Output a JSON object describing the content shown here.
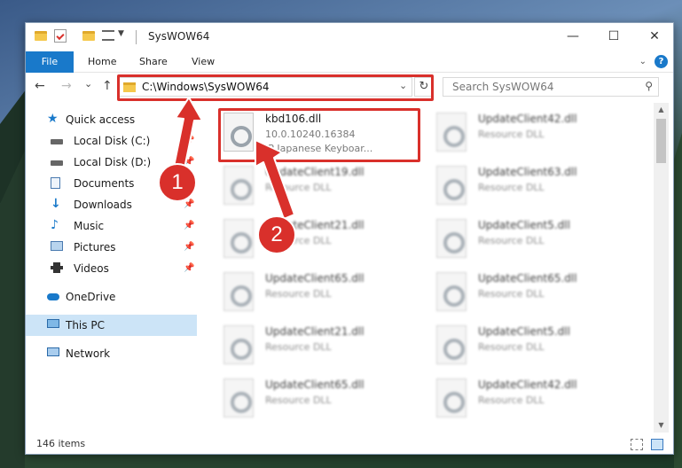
{
  "window": {
    "title": "SysWOW64",
    "controls": {
      "minimize": "—",
      "maximize": "☐",
      "close": "✕"
    }
  },
  "ribbon": {
    "tabs": [
      "File",
      "Home",
      "Share",
      "View"
    ],
    "help": "?"
  },
  "nav": {
    "back": "←",
    "forward": "→",
    "recent": "⌄",
    "up": "↑",
    "address": "C:\\Windows\\SysWOW64",
    "address_dropdown": "⌄",
    "refresh": "↻",
    "search_placeholder": "Search SysWOW64"
  },
  "sidebar": {
    "items": [
      {
        "label": "Quick access",
        "icon": "star-icon",
        "pinned": false,
        "level": 0
      },
      {
        "label": "Local Disk (C:)",
        "icon": "drive-icon",
        "pinned": true,
        "level": 1
      },
      {
        "label": "Local Disk (D:)",
        "icon": "drive-icon",
        "pinned": true,
        "level": 1
      },
      {
        "label": "Documents",
        "icon": "documents-icon",
        "pinned": true,
        "level": 1
      },
      {
        "label": "Downloads",
        "icon": "download-icon",
        "pinned": true,
        "level": 1
      },
      {
        "label": "Music",
        "icon": "music-icon",
        "pinned": true,
        "level": 1
      },
      {
        "label": "Pictures",
        "icon": "pictures-icon",
        "pinned": true,
        "level": 1
      },
      {
        "label": "Videos",
        "icon": "videos-icon",
        "pinned": true,
        "level": 1
      },
      {
        "label": "OneDrive",
        "icon": "cloud-icon",
        "pinned": false,
        "level": 0
      },
      {
        "label": "This PC",
        "icon": "computer-icon",
        "pinned": false,
        "level": 0,
        "selected": true
      },
      {
        "label": "Network",
        "icon": "network-icon",
        "pinned": false,
        "level": 0
      }
    ],
    "pin_glyph": "📌"
  },
  "files": {
    "left": [
      {
        "name": "kbd106.dll",
        "sub": "10.0.10240.16384",
        "sub2": "JP Japanese Keyboar...",
        "highlighted": true
      },
      {
        "name": "UpdateClient19.dll",
        "sub": "Resource DLL"
      },
      {
        "name": "UpdateClient21.dll",
        "sub": "Resource DLL"
      },
      {
        "name": "UpdateClient65.dll",
        "sub": "Resource DLL"
      },
      {
        "name": "UpdateClient21.dll",
        "sub": "Resource DLL"
      },
      {
        "name": "UpdateClient65.dll",
        "sub": "Resource DLL"
      }
    ],
    "right": [
      {
        "name": "UpdateClient42.dll",
        "sub": "Resource DLL"
      },
      {
        "name": "UpdateClient63.dll",
        "sub": "Resource DLL"
      },
      {
        "name": "UpdateClient5.dll",
        "sub": "Resource DLL"
      },
      {
        "name": "UpdateClient65.dll",
        "sub": "Resource DLL"
      },
      {
        "name": "UpdateClient5.dll",
        "sub": "Resource DLL"
      },
      {
        "name": "UpdateClient42.dll",
        "sub": "Resource DLL"
      }
    ]
  },
  "status": {
    "count": "146 items"
  },
  "callouts": [
    "1",
    "2"
  ],
  "colors": {
    "accent": "#1979ca",
    "highlight": "#d9302b",
    "selected": "#cce4f7"
  }
}
